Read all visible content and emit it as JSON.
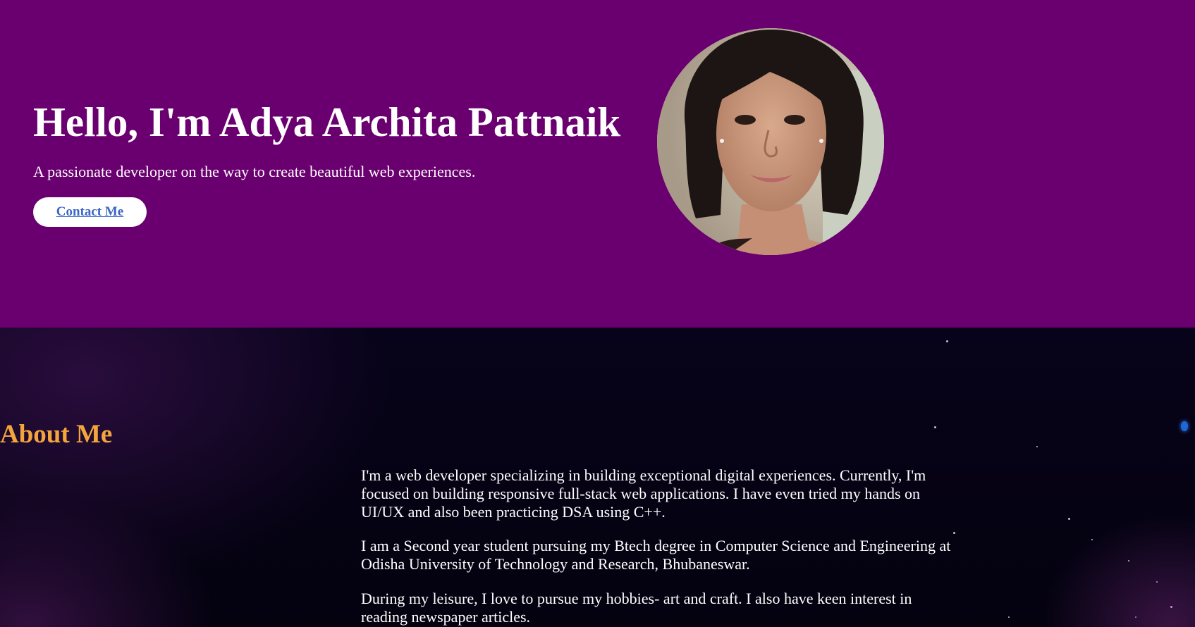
{
  "hero": {
    "title": "Hello, I'm Adya Archita Pattnaik",
    "subtitle": "A passionate developer on the way to create beautiful web experiences.",
    "contact_label": "Contact Me",
    "background_color": "#6a006f",
    "button_text_color": "#3b66c8"
  },
  "about": {
    "heading": "About Me",
    "heading_color": "#f3a43d",
    "paragraphs": [
      "I'm a web developer specializing in building exceptional digital experiences. Currently, I'm focused on building responsive full-stack web applications. I have even tried my hands on UI/UX and also been practicing DSA using C++.",
      "I am a Second year student pursuing my Btech degree in Computer Science and Engineering at Odisha University of Technology and Research, Bhubaneswar.",
      "During my leisure, I love to pursue my hobbies- art and craft. I also have keen interest in reading newspaper articles."
    ]
  }
}
